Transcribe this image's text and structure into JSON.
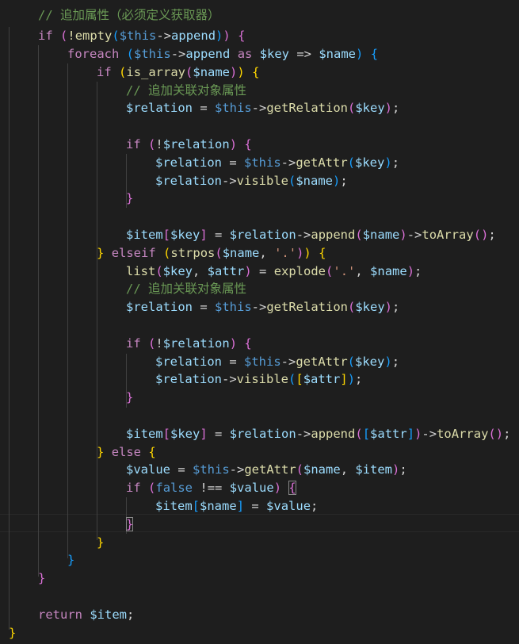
{
  "editor": {
    "language": "php",
    "theme": "dark",
    "lines": [
      [
        [
          "// 追加属性（必须定义获取器）",
          "cmt"
        ]
      ],
      [
        [
          "if",
          "kw"
        ],
        [
          " ",
          ""
        ],
        [
          "(",
          "b2"
        ],
        [
          "!empty",
          "fn"
        ],
        [
          "(",
          "b3"
        ],
        [
          "$this",
          "kb"
        ],
        [
          "->",
          "op"
        ],
        [
          "append",
          "var"
        ],
        [
          ")",
          "b3"
        ],
        [
          ")",
          "b2"
        ],
        [
          " ",
          ""
        ],
        [
          "{",
          "b2"
        ]
      ],
      [
        [
          "foreach",
          "kw"
        ],
        [
          " ",
          ""
        ],
        [
          "(",
          "b3"
        ],
        [
          "$this",
          "kb"
        ],
        [
          "->",
          "op"
        ],
        [
          "append",
          "var"
        ],
        [
          " as ",
          "kw"
        ],
        [
          "$key",
          "var"
        ],
        [
          " => ",
          "op"
        ],
        [
          "$name",
          "var"
        ],
        [
          ")",
          "b3"
        ],
        [
          " ",
          ""
        ],
        [
          "{",
          "b3"
        ]
      ],
      [
        [
          "if",
          "kw"
        ],
        [
          " ",
          ""
        ],
        [
          "(",
          "b1"
        ],
        [
          "is_array",
          "fn"
        ],
        [
          "(",
          "b2"
        ],
        [
          "$name",
          "var"
        ],
        [
          ")",
          "b2"
        ],
        [
          ")",
          "b1"
        ],
        [
          " ",
          ""
        ],
        [
          "{",
          "b1"
        ]
      ],
      [
        [
          "// 追加关联对象属性",
          "cmt"
        ]
      ],
      [
        [
          "$relation",
          "var"
        ],
        [
          " = ",
          "op"
        ],
        [
          "$this",
          "kb"
        ],
        [
          "->",
          "op"
        ],
        [
          "getRelation",
          "fn"
        ],
        [
          "(",
          "b2"
        ],
        [
          "$key",
          "var"
        ],
        [
          ")",
          "b2"
        ],
        [
          ";",
          "op"
        ]
      ],
      [],
      [
        [
          "if",
          "kw"
        ],
        [
          " ",
          ""
        ],
        [
          "(",
          "b2"
        ],
        [
          "!",
          "op"
        ],
        [
          "$relation",
          "var"
        ],
        [
          ")",
          "b2"
        ],
        [
          " ",
          ""
        ],
        [
          "{",
          "b2"
        ]
      ],
      [
        [
          "$relation",
          "var"
        ],
        [
          " = ",
          "op"
        ],
        [
          "$this",
          "kb"
        ],
        [
          "->",
          "op"
        ],
        [
          "getAttr",
          "fn"
        ],
        [
          "(",
          "b3"
        ],
        [
          "$key",
          "var"
        ],
        [
          ")",
          "b3"
        ],
        [
          ";",
          "op"
        ]
      ],
      [
        [
          "$relation",
          "var"
        ],
        [
          "->",
          "op"
        ],
        [
          "visible",
          "fn"
        ],
        [
          "(",
          "b3"
        ],
        [
          "$name",
          "var"
        ],
        [
          ")",
          "b3"
        ],
        [
          ";",
          "op"
        ]
      ],
      [
        [
          "}",
          "b2"
        ]
      ],
      [],
      [
        [
          "$item",
          "var"
        ],
        [
          "[",
          "b2"
        ],
        [
          "$key",
          "var"
        ],
        [
          "]",
          "b2"
        ],
        [
          " = ",
          "op"
        ],
        [
          "$relation",
          "var"
        ],
        [
          "->",
          "op"
        ],
        [
          "append",
          "fn"
        ],
        [
          "(",
          "b2"
        ],
        [
          "$name",
          "var"
        ],
        [
          ")",
          "b2"
        ],
        [
          "->",
          "op"
        ],
        [
          "toArray",
          "fn"
        ],
        [
          "(",
          "b2"
        ],
        [
          ")",
          "b2"
        ],
        [
          ";",
          "op"
        ]
      ],
      [
        [
          "}",
          "b1"
        ],
        [
          " ",
          ""
        ],
        [
          "elseif",
          "kw"
        ],
        [
          " ",
          ""
        ],
        [
          "(",
          "b1"
        ],
        [
          "strpos",
          "fn"
        ],
        [
          "(",
          "b2"
        ],
        [
          "$name",
          "var"
        ],
        [
          ", ",
          "op"
        ],
        [
          "'.'",
          "str"
        ],
        [
          ")",
          "b2"
        ],
        [
          ")",
          "b1"
        ],
        [
          " ",
          ""
        ],
        [
          "{",
          "b1"
        ]
      ],
      [
        [
          "list",
          "fn"
        ],
        [
          "(",
          "b2"
        ],
        [
          "$key",
          "var"
        ],
        [
          ", ",
          "op"
        ],
        [
          "$attr",
          "var"
        ],
        [
          ")",
          "b2"
        ],
        [
          " = ",
          "op"
        ],
        [
          "explode",
          "fn"
        ],
        [
          "(",
          "b2"
        ],
        [
          "'.'",
          "str"
        ],
        [
          ", ",
          "op"
        ],
        [
          "$name",
          "var"
        ],
        [
          ")",
          "b2"
        ],
        [
          ";",
          "op"
        ]
      ],
      [
        [
          "// 追加关联对象属性",
          "cmt"
        ]
      ],
      [
        [
          "$relation",
          "var"
        ],
        [
          " = ",
          "op"
        ],
        [
          "$this",
          "kb"
        ],
        [
          "->",
          "op"
        ],
        [
          "getRelation",
          "fn"
        ],
        [
          "(",
          "b2"
        ],
        [
          "$key",
          "var"
        ],
        [
          ")",
          "b2"
        ],
        [
          ";",
          "op"
        ]
      ],
      [],
      [
        [
          "if",
          "kw"
        ],
        [
          " ",
          ""
        ],
        [
          "(",
          "b2"
        ],
        [
          "!",
          "op"
        ],
        [
          "$relation",
          "var"
        ],
        [
          ")",
          "b2"
        ],
        [
          " ",
          ""
        ],
        [
          "{",
          "b2"
        ]
      ],
      [
        [
          "$relation",
          "var"
        ],
        [
          " = ",
          "op"
        ],
        [
          "$this",
          "kb"
        ],
        [
          "->",
          "op"
        ],
        [
          "getAttr",
          "fn"
        ],
        [
          "(",
          "b3"
        ],
        [
          "$key",
          "var"
        ],
        [
          ")",
          "b3"
        ],
        [
          ";",
          "op"
        ]
      ],
      [
        [
          "$relation",
          "var"
        ],
        [
          "->",
          "op"
        ],
        [
          "visible",
          "fn"
        ],
        [
          "(",
          "b3"
        ],
        [
          "[",
          "b1"
        ],
        [
          "$attr",
          "var"
        ],
        [
          "]",
          "b1"
        ],
        [
          ")",
          "b3"
        ],
        [
          ";",
          "op"
        ]
      ],
      [
        [
          "}",
          "b2"
        ]
      ],
      [],
      [
        [
          "$item",
          "var"
        ],
        [
          "[",
          "b2"
        ],
        [
          "$key",
          "var"
        ],
        [
          "]",
          "b2"
        ],
        [
          " = ",
          "op"
        ],
        [
          "$relation",
          "var"
        ],
        [
          "->",
          "op"
        ],
        [
          "append",
          "fn"
        ],
        [
          "(",
          "b2"
        ],
        [
          "[",
          "b3"
        ],
        [
          "$attr",
          "var"
        ],
        [
          "]",
          "b3"
        ],
        [
          ")",
          "b2"
        ],
        [
          "->",
          "op"
        ],
        [
          "toArray",
          "fn"
        ],
        [
          "(",
          "b2"
        ],
        [
          ")",
          "b2"
        ],
        [
          ";",
          "op"
        ]
      ],
      [
        [
          "}",
          "b1"
        ],
        [
          " ",
          ""
        ],
        [
          "else",
          "kw"
        ],
        [
          " ",
          ""
        ],
        [
          "{",
          "b1"
        ]
      ],
      [
        [
          "$value",
          "var"
        ],
        [
          " = ",
          "op"
        ],
        [
          "$this",
          "kb"
        ],
        [
          "->",
          "op"
        ],
        [
          "getAttr",
          "fn"
        ],
        [
          "(",
          "b2"
        ],
        [
          "$name",
          "var"
        ],
        [
          ", ",
          "op"
        ],
        [
          "$item",
          "var"
        ],
        [
          ")",
          "b2"
        ],
        [
          ";",
          "op"
        ]
      ],
      [
        [
          "if",
          "kw"
        ],
        [
          " ",
          ""
        ],
        [
          "(",
          "b2"
        ],
        [
          "false",
          "kb"
        ],
        [
          " !== ",
          "op"
        ],
        [
          "$value",
          "var"
        ],
        [
          ")",
          "b2"
        ],
        [
          " ",
          ""
        ],
        [
          "{",
          "b2 match"
        ]
      ],
      [
        [
          "$item",
          "var"
        ],
        [
          "[",
          "b3"
        ],
        [
          "$name",
          "var"
        ],
        [
          "]",
          "b3"
        ],
        [
          " = ",
          "op"
        ],
        [
          "$value",
          "var"
        ],
        [
          ";",
          "op"
        ]
      ],
      [
        [
          "}",
          "b2 match"
        ]
      ],
      [
        [
          "}",
          "b1"
        ]
      ],
      [
        [
          "}",
          "b3"
        ]
      ],
      [
        [
          "}",
          "b2"
        ]
      ],
      [],
      [
        [
          "return",
          "kw"
        ],
        [
          " ",
          ""
        ],
        [
          "$item",
          "var"
        ],
        [
          ";",
          "op"
        ]
      ],
      [
        [
          "}",
          "b1"
        ]
      ]
    ]
  }
}
